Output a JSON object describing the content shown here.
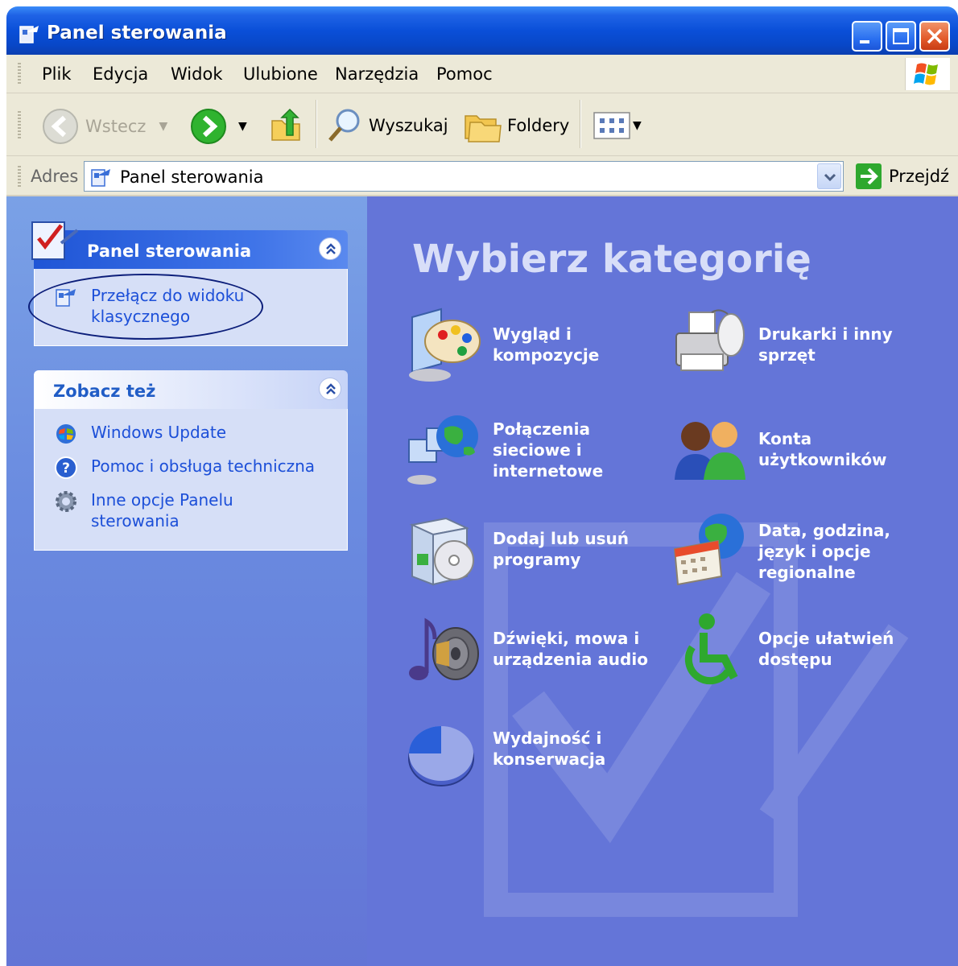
{
  "window": {
    "title": "Panel sterowania"
  },
  "menu": [
    "Plik",
    "Edycja",
    "Widok",
    "Ulubione",
    "Narzędzia",
    "Pomoc"
  ],
  "toolbar": {
    "back_label": "Wstecz",
    "search_label": "Wyszukaj",
    "folders_label": "Foldery"
  },
  "address": {
    "label": "Adres",
    "value": "Panel sterowania",
    "go_label": "Przejdź"
  },
  "tasks_panel": {
    "title": "Panel sterowania",
    "link": "Przełącz do widoku klasycznego"
  },
  "see_also": {
    "title": "Zobacz też",
    "links": [
      "Windows Update",
      "Pomoc i obsługa techniczna",
      "Inne opcje Panelu sterowania"
    ]
  },
  "main": {
    "heading": "Wybierz kategorię",
    "categories": [
      {
        "label": "Wygląd i kompozycje",
        "icon": "appearance-icon"
      },
      {
        "label": "Drukarki i inny sprzęt",
        "icon": "printer-icon"
      },
      {
        "label": "Połączenia sieciowe i internetowe",
        "icon": "network-icon"
      },
      {
        "label": "Konta użytkowników",
        "icon": "user-accounts-icon"
      },
      {
        "label": "Dodaj lub usuń programy",
        "icon": "add-remove-programs-icon"
      },
      {
        "label": "Data, godzina, język i opcje regionalne",
        "icon": "date-time-globe-icon"
      },
      {
        "label": "Dźwięki, mowa i urządzenia audio",
        "icon": "sound-icon"
      },
      {
        "label": "Opcje ułatwień dostępu",
        "icon": "accessibility-icon"
      },
      {
        "label": "Wydajność i konserwacja",
        "icon": "performance-icon"
      }
    ]
  },
  "colors": {
    "titlebar": "#0a4fd8",
    "left_pane": "#6a8be0",
    "right_pane": "#6475d8",
    "link": "#1c4fd8"
  }
}
